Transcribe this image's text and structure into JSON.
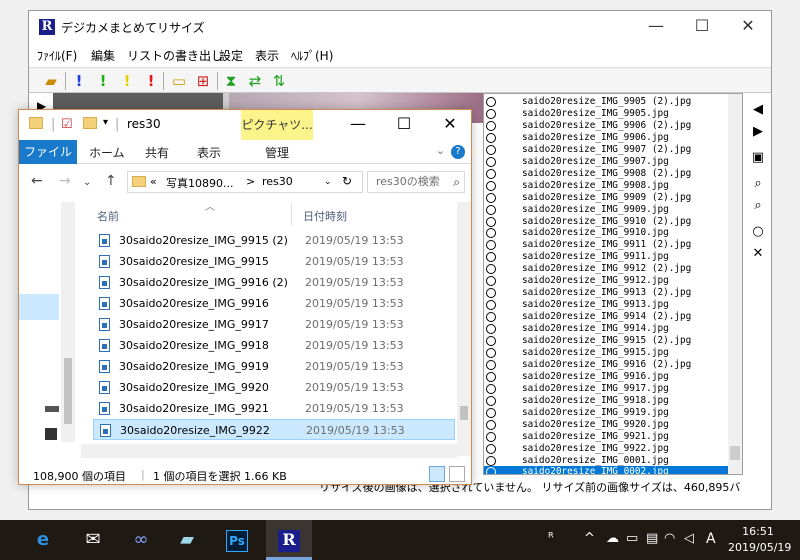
{
  "app": {
    "title": "デジカメまとめてリサイズ",
    "logo_letter": "R",
    "menu": [
      "ﾌｧｲﾙ(F)",
      "編集",
      "リストの書き出し",
      "設定",
      "表示",
      "ﾍﾙﾌﾟ(H)"
    ],
    "status_text": "リサイズ後の画像は、選択されていません。 リサイズ前の画像サイズは、460,895バ",
    "file_list": [
      "saido20resize_IMG_9905 (2).jpg",
      "saido20resize_IMG_9905.jpg",
      "saido20resize_IMG_9906 (2).jpg",
      "saido20resize_IMG_9906.jpg",
      "saido20resize_IMG_9907 (2).jpg",
      "saido20resize_IMG_9907.jpg",
      "saido20resize_IMG_9908 (2).jpg",
      "saido20resize_IMG_9908.jpg",
      "saido20resize_IMG_9909 (2).jpg",
      "saido20resize_IMG_9909.jpg",
      "saido20resize_IMG_9910 (2).jpg",
      "saido20resize_IMG_9910.jpg",
      "saido20resize_IMG_9911 (2).jpg",
      "saido20resize_IMG_9911.jpg",
      "saido20resize_IMG_9912 (2).jpg",
      "saido20resize_IMG_9912.jpg",
      "saido20resize_IMG_9913 (2).jpg",
      "saido20resize_IMG_9913.jpg",
      "saido20resize_IMG_9914 (2).jpg",
      "saido20resize_IMG_9914.jpg",
      "saido20resize_IMG_9915 (2).jpg",
      "saido20resize_IMG_9915.jpg",
      "saido20resize_IMG_9916 (2).jpg",
      "saido20resize_IMG_9916.jpg",
      "saido20resize_IMG_9917.jpg",
      "saido20resize_IMG_9918.jpg",
      "saido20resize_IMG_9919.jpg",
      "saido20resize_IMG_9920.jpg",
      "saido20resize_IMG_9921.jpg",
      "saido20resize_IMG_9922.jpg",
      "saido20resize_IMG_0001.jpg",
      "saido20resize_IMG_0002.jpg"
    ],
    "file_list_selected": "saido20resize_IMG_0002.jpg"
  },
  "explorer": {
    "title": "res30",
    "context_tab": "ピクチャツ...",
    "ribbon_tabs": {
      "file": "ファイル",
      "home": "ホーム",
      "share": "共有",
      "view": "表示",
      "manage": "管理"
    },
    "help": "?",
    "address": {
      "prefix": "«",
      "crumb1": "写真10890...",
      "sep": ">",
      "crumb2": "res30"
    },
    "search_placeholder": "res30の検索",
    "columns": {
      "name": "名前",
      "date": "日付時刻"
    },
    "rows": [
      {
        "name": "30saido20resize_IMG_9915 (2)",
        "date": "2019/05/19 13:53"
      },
      {
        "name": "30saido20resize_IMG_9915",
        "date": "2019/05/19 13:53"
      },
      {
        "name": "30saido20resize_IMG_9916 (2)",
        "date": "2019/05/19 13:53"
      },
      {
        "name": "30saido20resize_IMG_9916",
        "date": "2019/05/19 13:53"
      },
      {
        "name": "30saido20resize_IMG_9917",
        "date": "2019/05/19 13:53"
      },
      {
        "name": "30saido20resize_IMG_9918",
        "date": "2019/05/19 13:53"
      },
      {
        "name": "30saido20resize_IMG_9919",
        "date": "2019/05/19 13:53"
      },
      {
        "name": "30saido20resize_IMG_9920",
        "date": "2019/05/19 13:53"
      },
      {
        "name": "30saido20resize_IMG_9921",
        "date": "2019/05/19 13:53"
      },
      {
        "name": "30saido20resize_IMG_9922",
        "date": "2019/05/19 13:53"
      }
    ],
    "selected_row": "30saido20resize_IMG_9922",
    "status": {
      "items": "108,900 個の項目",
      "selection": "1 個の項目を選択  1.66 KB"
    }
  },
  "taskbar": {
    "apps": [
      "edge-icon",
      "mail-icon",
      "link-icon",
      "notes-icon",
      "photoshop-icon",
      "resize-app-icon"
    ],
    "photoshop_label": "Ps",
    "resize_label": "R",
    "ime": "A",
    "time": "16:51",
    "date": "2019/05/19"
  },
  "colors": {
    "accent": "#0078d7",
    "ribbon_file": "#1979ca",
    "context_tab": "#fcf38a",
    "taskbar": "#1f1913"
  }
}
